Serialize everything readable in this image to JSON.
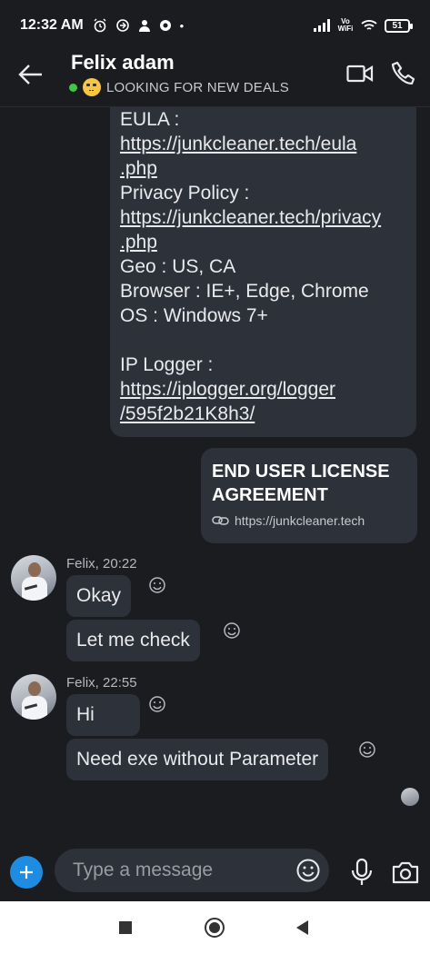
{
  "status_bar": {
    "time": "12:32 AM",
    "network_label": "Vo WiFi",
    "battery": "51"
  },
  "header": {
    "contact_name": "Felix adam",
    "status_text": "LOOKING FOR NEW DEALS",
    "back_icon": "arrow-left-icon",
    "video_icon": "video-camera-icon",
    "call_icon": "phone-icon",
    "online_color": "#41c744"
  },
  "messages": {
    "outgoing_block": {
      "lines": [
        "EULA :",
        "https://junkcleaner.tech/eula",
        ".php",
        "Privacy Policy :",
        "https://junkcleaner.tech/privacy",
        ".php",
        "Geo : US, CA",
        "Browser : IE+, Edge, Chrome",
        "OS : Windows 7+",
        "",
        "IP Logger :",
        "https://iplogger.org/logger",
        "/595f2b21K8h3/"
      ]
    },
    "link_preview": {
      "title": "END USER LICENSE AGREEMENT",
      "url": "https://junkcleaner.tech"
    },
    "group1": {
      "sender": "Felix, 20:22",
      "bubbles": [
        "Okay",
        "Let me check"
      ]
    },
    "group2": {
      "sender": "Felix, 22:55",
      "bubbles": [
        "Hi",
        "Need exe without Parameter"
      ]
    }
  },
  "composer": {
    "placeholder": "Type a message"
  },
  "colors": {
    "background": "#1b1c20",
    "bubble": "#2d3139",
    "accent": "#1e8ce0"
  }
}
